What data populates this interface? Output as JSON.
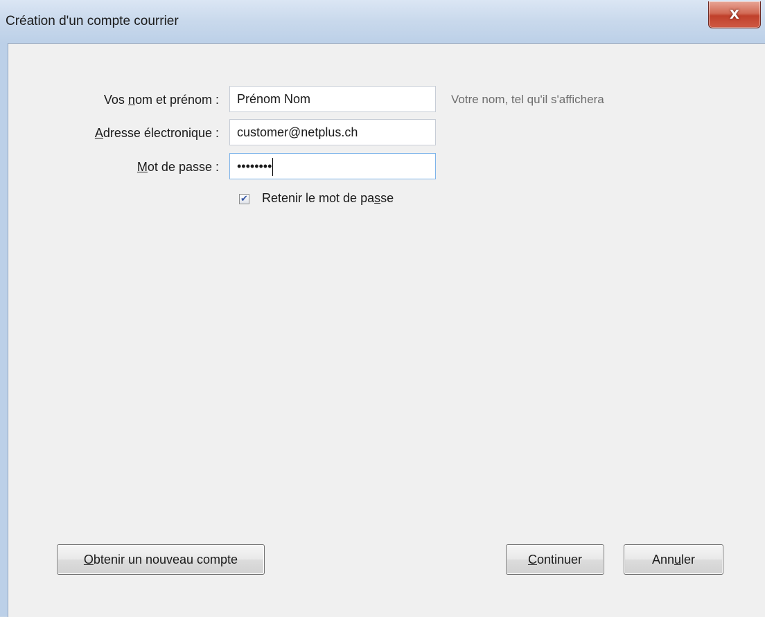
{
  "window": {
    "title": "Création d'un compte courrier",
    "close_label": "X"
  },
  "form": {
    "name": {
      "label_before": "Vos ",
      "label_key": "n",
      "label_after": "om et prénom :",
      "value": "Prénom Nom",
      "hint": "Votre nom, tel qu'il s'affichera"
    },
    "email": {
      "label_before": "",
      "label_key": "A",
      "label_after": "dresse électronique :",
      "value": "customer@netplus.ch"
    },
    "password": {
      "label_before": "",
      "label_key": "M",
      "label_after": "ot de passe :",
      "value": "••••••••"
    },
    "remember": {
      "checked": true,
      "label_before": "Retenir le mot de pa",
      "label_key": "s",
      "label_after": "se"
    }
  },
  "buttons": {
    "new_account": {
      "key": "O",
      "rest": "btenir un nouveau compte"
    },
    "continue": {
      "key": "C",
      "rest": "ontinuer"
    },
    "cancel": {
      "before": "Ann",
      "key": "u",
      "after": "ler"
    }
  }
}
